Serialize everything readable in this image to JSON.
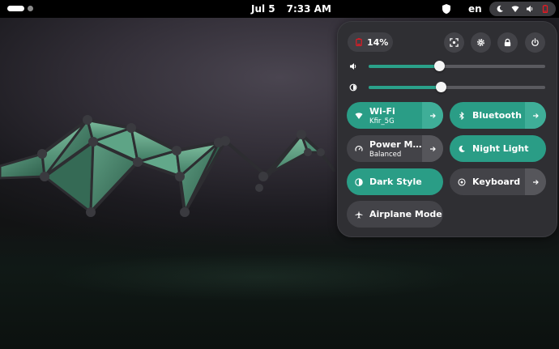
{
  "topbar": {
    "date": "Jul 5",
    "time": "7:33 AM",
    "language": "en",
    "icons": [
      "shield-icon",
      "night-light-icon",
      "wifi-icon",
      "volume-icon",
      "battery-icon"
    ]
  },
  "quick_settings": {
    "battery": {
      "label": "14%",
      "icon": "battery-low-icon",
      "level_percent": 14
    },
    "buttons": [
      {
        "name": "screenshot-button",
        "icon": "screenshot-icon"
      },
      {
        "name": "settings-button",
        "icon": "gear-icon"
      },
      {
        "name": "lock-button",
        "icon": "lock-icon"
      },
      {
        "name": "power-button",
        "icon": "power-icon"
      }
    ],
    "sliders": [
      {
        "name": "volume-slider",
        "icon": "volume-icon",
        "value_percent": 40
      },
      {
        "name": "brightness-slider",
        "icon": "brightness-icon",
        "value_percent": 41
      }
    ],
    "tiles": {
      "wifi": {
        "title": "Wi-Fi",
        "subtitle": "Kfir_5G",
        "active": true,
        "icon": "wifi-icon"
      },
      "bluetooth": {
        "title": "Bluetooth",
        "subtitle": "",
        "active": true,
        "icon": "bluetooth-icon"
      },
      "power_mode": {
        "title": "Power Mo…",
        "subtitle": "Balanced",
        "active": false,
        "icon": "power-mode-icon"
      },
      "night_light": {
        "title": "Night Light",
        "subtitle": "",
        "active": true,
        "icon": "moon-icon"
      },
      "dark_style": {
        "title": "Dark Style",
        "subtitle": "",
        "active": true,
        "icon": "dark-style-icon"
      },
      "keyboard": {
        "title": "Keyboard",
        "subtitle": "",
        "active": false,
        "icon": "keyboard-icon"
      },
      "airplane": {
        "title": "Airplane Mode",
        "subtitle": "",
        "active": false,
        "icon": "airplane-icon"
      }
    }
  },
  "colors": {
    "accent": "#2a9d86",
    "tile_off": "#434348",
    "panel_bg": "#2f2f33",
    "battery_low": "#e01b24"
  }
}
